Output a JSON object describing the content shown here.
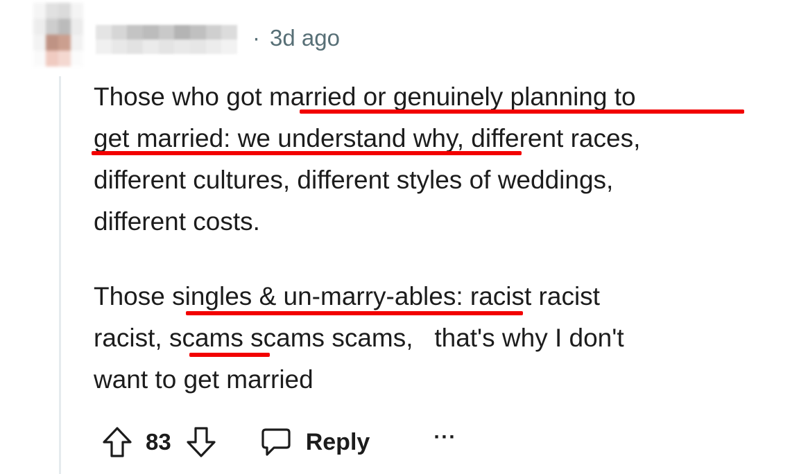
{
  "comment": {
    "author_blurred": true,
    "timestamp": "3d ago",
    "separator": "·",
    "paragraphs": [
      {
        "lines": [
          "Those who got married or genuinely planning to",
          "get married: we understand why, different races,",
          "different cultures, different styles of weddings,",
          "different costs."
        ]
      },
      {
        "lines": [
          "Those singles & un-marry-ables: racist racist",
          "racist, scams scams scams,   that's why I don't",
          "want to get married"
        ]
      }
    ],
    "highlights": [
      "married or genuinely planning to",
      "get married: we understand why",
      "singles & un-marry-ables",
      "scams"
    ],
    "highlight_color": "#f20000"
  },
  "actions": {
    "vote_count": "83",
    "reply_label": "Reply",
    "more_label": "···",
    "upvote_icon": "arrow-up-icon",
    "downvote_icon": "arrow-down-icon",
    "reply_icon": "speech-bubble-icon"
  }
}
